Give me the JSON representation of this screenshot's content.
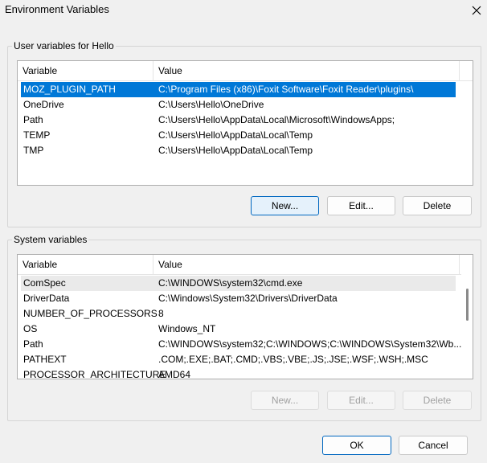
{
  "window": {
    "title": "Environment Variables",
    "close_icon": "close-icon"
  },
  "user_section": {
    "label": "User variables for Hello",
    "headers": {
      "variable": "Variable",
      "value": "Value"
    },
    "rows": [
      {
        "variable": "MOZ_PLUGIN_PATH",
        "value": "C:\\Program Files (x86)\\Foxit Software\\Foxit Reader\\plugins\\"
      },
      {
        "variable": "OneDrive",
        "value": "C:\\Users\\Hello\\OneDrive"
      },
      {
        "variable": "Path",
        "value": "C:\\Users\\Hello\\AppData\\Local\\Microsoft\\WindowsApps;"
      },
      {
        "variable": "TEMP",
        "value": "C:\\Users\\Hello\\AppData\\Local\\Temp"
      },
      {
        "variable": "TMP",
        "value": "C:\\Users\\Hello\\AppData\\Local\\Temp"
      }
    ],
    "selected_row": "MOZ_PLUGIN_PATH",
    "buttons": {
      "new": "New...",
      "edit": "Edit...",
      "delete": "Delete"
    }
  },
  "system_section": {
    "label": "System variables",
    "headers": {
      "variable": "Variable",
      "value": "Value"
    },
    "rows": [
      {
        "variable": "ComSpec",
        "value": "C:\\WINDOWS\\system32\\cmd.exe"
      },
      {
        "variable": "DriverData",
        "value": "C:\\Windows\\System32\\Drivers\\DriverData"
      },
      {
        "variable": "NUMBER_OF_PROCESSORS",
        "value": "8"
      },
      {
        "variable": "OS",
        "value": "Windows_NT"
      },
      {
        "variable": "Path",
        "value": "C:\\WINDOWS\\system32;C:\\WINDOWS;C:\\WINDOWS\\System32\\Wb..."
      },
      {
        "variable": "PATHEXT",
        "value": ".COM;.EXE;.BAT;.CMD;.VBS;.VBE;.JS;.JSE;.WSF;.WSH;.MSC"
      },
      {
        "variable": "PROCESSOR_ARCHITECTURE",
        "value": "AMD64"
      }
    ],
    "hover_row": "ComSpec",
    "buttons": {
      "new": "New...",
      "edit": "Edit...",
      "delete": "Delete"
    }
  },
  "footer": {
    "ok": "OK",
    "cancel": "Cancel"
  },
  "colors": {
    "selection": "#0078d7",
    "accent_border": "#0067c0",
    "background": "#f0f0f0"
  }
}
